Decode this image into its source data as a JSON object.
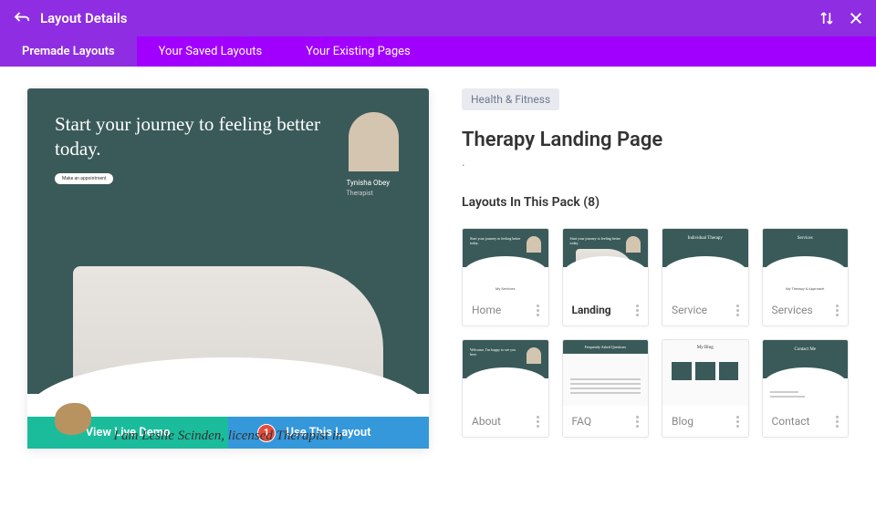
{
  "header": {
    "title": "Layout Details"
  },
  "tabs": [
    "Premade Layouts",
    "Your Saved Layouts",
    "Your Existing Pages"
  ],
  "preview": {
    "heroTitle": "Start your journey to feeling better today.",
    "pillLabel": "Make an appointment",
    "personName": "Tynisha Obey",
    "personRole": "Therapist",
    "subtitle": "I am Leslie Scinden, licensed Therapist in"
  },
  "actions": {
    "demo": "View Live Demo",
    "use": "Use This Layout",
    "marker": "1"
  },
  "details": {
    "tag": "Health & Fitness",
    "title": "Therapy Landing Page",
    "packTitle": "Layouts In This Pack (8)"
  },
  "cards": [
    {
      "label": "Home"
    },
    {
      "label": "Landing"
    },
    {
      "label": "Service"
    },
    {
      "label": "Services"
    },
    {
      "label": "About"
    },
    {
      "label": "FAQ"
    },
    {
      "label": "Blog"
    },
    {
      "label": "Contact"
    }
  ],
  "thumbTexts": {
    "hero": "Start your journey to feeling better today.",
    "service": "Individual Therapy",
    "services": "Services",
    "servicesSub": "My Therapy & Approach",
    "about": "Welcome, I'm happy to see you here.",
    "faq": "Frequently Asked Questions",
    "blog": "My Blog",
    "contact": "Contact Me",
    "homeBottom": "My Services"
  }
}
